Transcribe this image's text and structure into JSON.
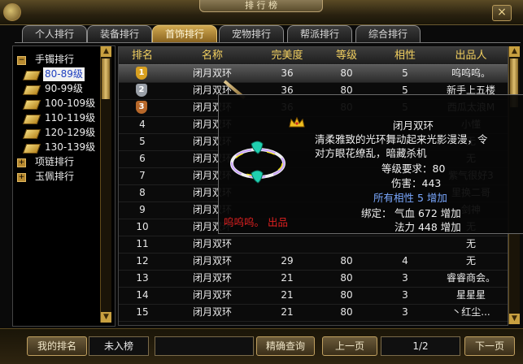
{
  "window": {
    "title": "排 行 榜",
    "close_label": "×"
  },
  "tabs": [
    {
      "label": "个人排行",
      "active": false
    },
    {
      "label": "装备排行",
      "active": false
    },
    {
      "label": "首饰排行",
      "active": true
    },
    {
      "label": "宠物排行",
      "active": false
    },
    {
      "label": "帮派排行",
      "active": false
    },
    {
      "label": "综合排行",
      "active": false
    }
  ],
  "sidebar": {
    "groups": [
      {
        "label": "手镯排行",
        "expanded": true,
        "toggle": "−"
      },
      {
        "label": "项链排行",
        "expanded": false,
        "toggle": "+"
      },
      {
        "label": "玉佩排行",
        "expanded": false,
        "toggle": "+"
      }
    ],
    "items": [
      "80-89级",
      "90-99级",
      "100-109级",
      "110-119级",
      "120-129级",
      "130-139级"
    ],
    "selected_index": 0
  },
  "table": {
    "headers": [
      "排名",
      "名称",
      "完美度",
      "等级",
      "相性",
      "出品人"
    ],
    "rows": [
      {
        "rank": "1",
        "name": "闭月双环",
        "perfect": "36",
        "level": "80",
        "attr": "5",
        "maker": "呜呜呜。"
      },
      {
        "rank": "2",
        "name": "闭月双环",
        "perfect": "36",
        "level": "80",
        "attr": "5",
        "maker": "新手上五楼"
      },
      {
        "rank": "3",
        "name": "闭月双环",
        "perfect": "36",
        "level": "80",
        "attr": "5",
        "maker": "西瓜太浪M"
      },
      {
        "rank": "4",
        "name": "闭月双环",
        "perfect": "",
        "level": "",
        "attr": "",
        "maker": "小懂"
      },
      {
        "rank": "5",
        "name": "闭月双环",
        "perfect": "",
        "level": "",
        "attr": "",
        "maker": "无"
      },
      {
        "rank": "6",
        "name": "闭月双环",
        "perfect": "",
        "level": "",
        "attr": "",
        "maker": "无"
      },
      {
        "rank": "7",
        "name": "闭月双环",
        "perfect": "",
        "level": "",
        "attr": "",
        "maker": "紫气很好3"
      },
      {
        "rank": "8",
        "name": "闭月双环",
        "perfect": "",
        "level": "",
        "attr": "",
        "maker": "里换二哥"
      },
      {
        "rank": "9",
        "name": "闭月双环",
        "perfect": "",
        "level": "",
        "attr": "",
        "maker": "剑神"
      },
      {
        "rank": "10",
        "name": "闭月双环",
        "perfect": "",
        "level": "",
        "attr": "",
        "maker": "无"
      },
      {
        "rank": "11",
        "name": "闭月双环",
        "perfect": "",
        "level": "",
        "attr": "",
        "maker": "无"
      },
      {
        "rank": "12",
        "name": "闭月双环",
        "perfect": "29",
        "level": "80",
        "attr": "4",
        "maker": "无"
      },
      {
        "rank": "13",
        "name": "闭月双环",
        "perfect": "21",
        "level": "80",
        "attr": "3",
        "maker": "睿睿商会。"
      },
      {
        "rank": "14",
        "name": "闭月双环",
        "perfect": "21",
        "level": "80",
        "attr": "3",
        "maker": "星星星"
      },
      {
        "rank": "15",
        "name": "闭月双环",
        "perfect": "21",
        "level": "80",
        "attr": "3",
        "maker": "丶红尘..."
      }
    ],
    "medal_colors": [
      "#d8a020",
      "#9aa0a8",
      "#b8682a"
    ]
  },
  "tooltip": {
    "title": "闭月双环",
    "desc_line1": "清柔雅致的光环舞动起来光影漫漫，令",
    "desc_line2": "对方眼花缭乱，暗藏杀机",
    "req": "等级要求：80",
    "damage": "伤害：443",
    "all_attr": "所有相性 5 增加",
    "bind_label": "绑定：",
    "stat1": "气血 672 增加",
    "stat2": "法力 448 增加",
    "maker_label": "呜呜呜。 出品",
    "crown_icon": "crown-icon"
  },
  "bottom": {
    "my_rank_label": "我的排名",
    "my_rank_value": "未入榜",
    "search_placeholder": "",
    "search_button": "精确查询",
    "prev_button": "上一页",
    "page_indicator": "1/2",
    "next_button": "下一页"
  }
}
